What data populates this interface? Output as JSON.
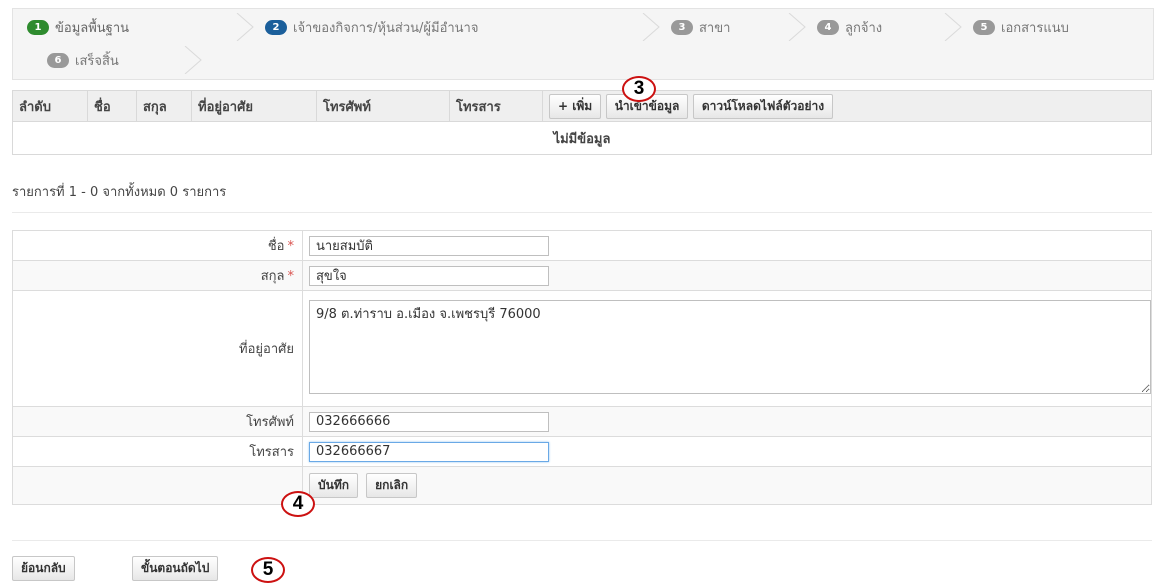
{
  "wizard": {
    "steps": [
      {
        "num": "1",
        "label": "ข้อมูลพื้นฐาน"
      },
      {
        "num": "2",
        "label": "เจ้าของกิจการ/หุ้นส่วน/ผู้มีอำนาจ"
      },
      {
        "num": "3",
        "label": "สาขา"
      },
      {
        "num": "4",
        "label": "ลูกจ้าง"
      },
      {
        "num": "5",
        "label": "เอกสารแนบ"
      },
      {
        "num": "6",
        "label": "เสร็จสิ้น"
      }
    ]
  },
  "grid": {
    "columns": [
      "ลำดับ",
      "ชื่อ",
      "สกุล",
      "ที่อยู่อาศัย",
      "โทรศัพท์",
      "โทรสาร"
    ],
    "add_button": "+ เพิ่ม",
    "import_button": "นำเข้าข้อมูล",
    "download_button": "ดาวน์โหลดไฟล์ตัวอย่าง",
    "empty_text": "ไม่มีข้อมูล"
  },
  "pager": {
    "text": "รายการที่ 1 - 0 จากทั้งหมด 0 รายการ"
  },
  "form": {
    "first_name": {
      "label": "ชื่อ",
      "value": "นายสมบัติ"
    },
    "last_name": {
      "label": "สกุล",
      "value": "สุขใจ"
    },
    "address": {
      "label": "ที่อยู่อาศัย",
      "value": "9/8 ต.ท่าราบ อ.เมือง จ.เพชรบุรี 76000"
    },
    "phone": {
      "label": "โทรศัพท์",
      "value": "032666666"
    },
    "fax": {
      "label": "โทรสาร",
      "value": "032666667"
    },
    "required_mark": "*",
    "save_button": "บันทึก",
    "cancel_button": "ยกเลิก"
  },
  "footer": {
    "back_button": "ย้อนกลับ",
    "next_button": "ขั้นตอนถัดไป"
  },
  "annotations": {
    "m3": "3",
    "m4": "4",
    "m5": "5"
  },
  "colors": {
    "step_done": "#2e8b2e",
    "step_current": "#1b5f9b",
    "marker_ring": "#cc1111",
    "required": "#d9534f"
  }
}
